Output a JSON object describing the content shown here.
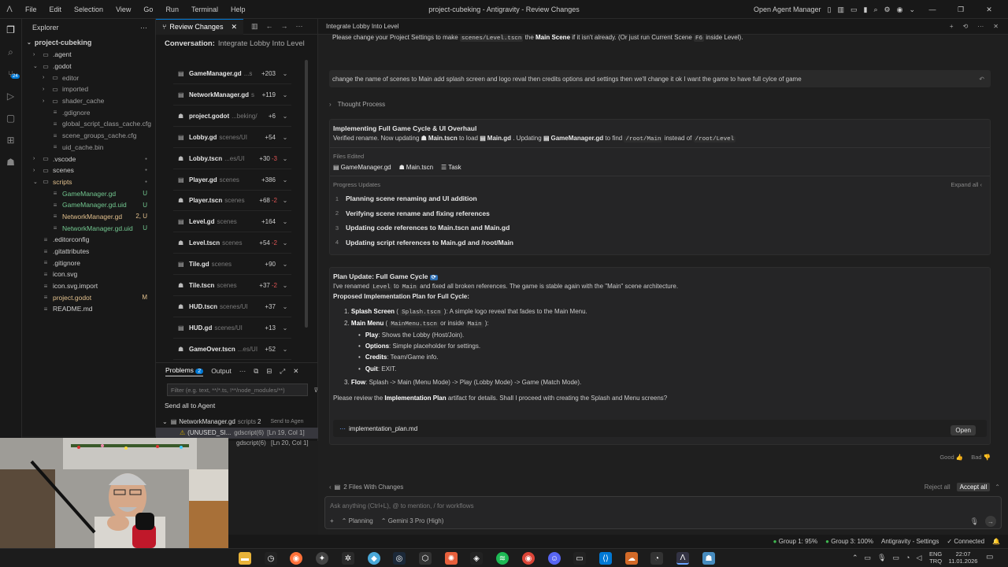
{
  "menubar": {
    "items": [
      "File",
      "Edit",
      "Selection",
      "View",
      "Go",
      "Run",
      "Terminal",
      "Help"
    ],
    "title": "project-cubeking - Antigravity - Review Changes",
    "agent_manager": "Open Agent Manager"
  },
  "explorer": {
    "header": "Explorer",
    "project": "project-cubeking",
    "tree": [
      {
        "label": ".agent",
        "kind": "folder",
        "depth": 1,
        "color": "#cccccc"
      },
      {
        "label": ".godot",
        "kind": "folder-open",
        "depth": 1,
        "color": "#cccccc"
      },
      {
        "label": "editor",
        "kind": "folder",
        "depth": 2,
        "color": "#9d9d9d"
      },
      {
        "label": "imported",
        "kind": "folder",
        "depth": 2,
        "color": "#9d9d9d"
      },
      {
        "label": "shader_cache",
        "kind": "folder",
        "depth": 2,
        "color": "#9d9d9d"
      },
      {
        "label": ".gdignore",
        "kind": "file",
        "depth": 2,
        "color": "#9d9d9d"
      },
      {
        "label": "global_script_class_cache.cfg",
        "kind": "file",
        "depth": 2,
        "color": "#9d9d9d"
      },
      {
        "label": "scene_groups_cache.cfg",
        "kind": "file",
        "depth": 2,
        "color": "#9d9d9d"
      },
      {
        "label": "uid_cache.bin",
        "kind": "file",
        "depth": 2,
        "color": "#9d9d9d"
      },
      {
        "label": ".vscode",
        "kind": "folder",
        "depth": 1,
        "color": "#cccccc",
        "dot": "true"
      },
      {
        "label": "scenes",
        "kind": "folder",
        "depth": 1,
        "color": "#cccccc",
        "dot": "true"
      },
      {
        "label": "scripts",
        "kind": "folder-open",
        "depth": 1,
        "color": "#e2c08d",
        "dot": "true"
      },
      {
        "label": "GameManager.gd",
        "kind": "file",
        "depth": 2,
        "color": "#73c991",
        "status": "U"
      },
      {
        "label": "GameManager.gd.uid",
        "kind": "file",
        "depth": 2,
        "color": "#73c991",
        "status": "U"
      },
      {
        "label": "NetworkManager.gd",
        "kind": "file",
        "depth": 2,
        "color": "#e2c08d",
        "status": "2, U"
      },
      {
        "label": "NetworkManager.gd.uid",
        "kind": "file",
        "depth": 2,
        "color": "#73c991",
        "status": "U"
      },
      {
        "label": ".editorconfig",
        "kind": "file",
        "depth": 1,
        "color": "#cccccc"
      },
      {
        "label": ".gitattributes",
        "kind": "file",
        "depth": 1,
        "color": "#cccccc"
      },
      {
        "label": ".gitignore",
        "kind": "file",
        "depth": 1,
        "color": "#cccccc"
      },
      {
        "label": "icon.svg",
        "kind": "file",
        "depth": 1,
        "color": "#cccccc"
      },
      {
        "label": "icon.svg.import",
        "kind": "file",
        "depth": 1,
        "color": "#cccccc"
      },
      {
        "label": "project.godot",
        "kind": "file",
        "depth": 1,
        "color": "#e2c08d",
        "status": "M"
      },
      {
        "label": "README.md",
        "kind": "file",
        "depth": 1,
        "color": "#cccccc"
      }
    ]
  },
  "review": {
    "tab": "Review Changes",
    "conversation_label": "Conversation:",
    "conversation_title": "Integrate Lobby Into Level",
    "files": [
      {
        "name": "GameManager.gd",
        "path": "...s",
        "add": "+203",
        "del": ""
      },
      {
        "name": "NetworkManager.gd",
        "path": "s",
        "add": "+119",
        "del": ""
      },
      {
        "name": "project.godot",
        "path": "...beking/",
        "add": "+6",
        "del": ""
      },
      {
        "name": "Lobby.gd",
        "path": "scenes/UI",
        "add": "+54",
        "del": ""
      },
      {
        "name": "Lobby.tscn",
        "path": "...es/UI",
        "add": "+30",
        "del": "-3"
      },
      {
        "name": "Player.gd",
        "path": "scenes",
        "add": "+386",
        "del": ""
      },
      {
        "name": "Player.tscn",
        "path": "scenes",
        "add": "+68",
        "del": "-2"
      },
      {
        "name": "Level.gd",
        "path": "scenes",
        "add": "+164",
        "del": ""
      },
      {
        "name": "Level.tscn",
        "path": "scenes",
        "add": "+54",
        "del": "-2"
      },
      {
        "name": "Tile.gd",
        "path": "scenes",
        "add": "+90",
        "del": ""
      },
      {
        "name": "Tile.tscn",
        "path": "scenes",
        "add": "+37",
        "del": "-2"
      },
      {
        "name": "HUD.tscn",
        "path": "scenes/UI",
        "add": "+37",
        "del": ""
      },
      {
        "name": "HUD.gd",
        "path": "scenes/UI",
        "add": "+13",
        "del": ""
      },
      {
        "name": "GameOver.tscn",
        "path": "...es/UI",
        "add": "+52",
        "del": ""
      }
    ]
  },
  "problems": {
    "tab_problems": "Problems",
    "problems_count": "2",
    "tab_output": "Output",
    "filter_placeholder": "Filter (e.g. text, **/*.ts, !**/node_modules/**)",
    "send_all": "Send all to Agent",
    "file": "NetworkManager.gd",
    "file_path": "scripts",
    "file_count": "2",
    "send_to_agent": "Send to Agen",
    "items": [
      {
        "text": "(UNUSED_SI...",
        "src": "gdscript(6)",
        "loc": "[Ln 19, Col 1]"
      },
      {
        "text": "",
        "src": "gdscript(6)",
        "loc": "[Ln 20, Col 1]"
      }
    ]
  },
  "chat": {
    "header": "Integrate Lobby Into Level",
    "top_line_pre": "Please change your Project Settings to make",
    "top_line_code": "scenes/Level.tscn",
    "top_line_mid": "the",
    "top_line_bold": "Main Scene",
    "top_line_post": "if it isn't already. (Or just run Current Scene",
    "top_line_code2": "F6",
    "top_line_end": "inside Level).",
    "user_message": "change the name of scenes to Main add splash screen and logo reval then credits options and settings then we'll change it ok I want the game to have full cylce of game",
    "thought_process": "Thought Process",
    "task_title": "Implementing Full Game Cycle & UI Overhaul",
    "task_text_1": "Verified rename. Now updating",
    "task_chip_1": "Main.tscn",
    "task_text_2": "to load",
    "task_chip_2": "Main.gd",
    "task_text_3": ". Updating",
    "task_chip_3": "GameManager.gd",
    "task_text_4": "to find",
    "task_code_1": "/root/Main",
    "task_text_5": "instead of",
    "task_code_2": "/root/Level",
    "files_edited_label": "Files Edited",
    "files_edited": [
      "GameManager.gd",
      "Main.tscn",
      "Task"
    ],
    "progress_label": "Progress Updates",
    "expand_all": "Expand all",
    "progress": [
      {
        "n": "1",
        "text": "Planning scene renaming and UI addition"
      },
      {
        "n": "2",
        "text": "Verifying scene rename and fixing references"
      },
      {
        "n": "3",
        "text": "Updating code references to Main.tscn and Main.gd"
      },
      {
        "n": "4",
        "text": "Updating script references to Main.gd and /root/Main"
      }
    ],
    "plan_title": "Plan Update: Full Game Cycle",
    "plan_intro_1": "I've renamed",
    "plan_code_level": "Level",
    "plan_intro_2": "to",
    "plan_code_main": "Main",
    "plan_intro_3": "and fixed all broken references. The game is stable again with the \"Main\" scene architecture.",
    "proposed": "Proposed Implementation Plan for Full Cycle:",
    "step1_num": "1.",
    "step1_bold": "Splash Screen",
    "step1_code": "Splash.tscn",
    "step1_text": ": A simple logo reveal that fades to the Main Menu.",
    "step2_num": "2.",
    "step2_bold": "Main Menu",
    "step2_code": "MainMenu.tscn",
    "step2_mid": "or inside",
    "step2_code2": "Main",
    "bullets": [
      {
        "b": "Play",
        "t": ": Shows the Lobby (Host/Join)."
      },
      {
        "b": "Options",
        "t": ": Simple placeholder for settings."
      },
      {
        "b": "Credits",
        "t": ": Team/Game info."
      },
      {
        "b": "Quit",
        "t": ": EXIT."
      }
    ],
    "step3_num": "3.",
    "step3_bold": "Flow",
    "step3_text": ": Splash -> Main (Menu Mode) -> Play (Lobby Mode) -> Game (Match Mode).",
    "review_pre": "Please review the",
    "review_bold": "Implementation Plan",
    "review_post": "artifact for details. Shall I proceed with creating the Splash and Menu screens?",
    "artifact": "implementation_plan.md",
    "open_btn": "Open",
    "good": "Good",
    "bad": "Bad",
    "files_with_changes": "2 Files With Changes",
    "reject_all": "Reject all",
    "accept_all": "Accept all",
    "input_placeholder": "Ask anything (Ctrl+L), @ to mention, / for workflows",
    "mode": "Planning",
    "model": "Gemini 3 Pro (High)"
  },
  "status": {
    "group1": "Group 1: 95%",
    "group3": "Group 3: 100%",
    "settings": "Antigravity - Settings",
    "connected": "Connected"
  },
  "taskbar": {
    "lang1": "ENG",
    "lang2": "TRQ",
    "time": "22:07",
    "date": "11.01.2026"
  }
}
